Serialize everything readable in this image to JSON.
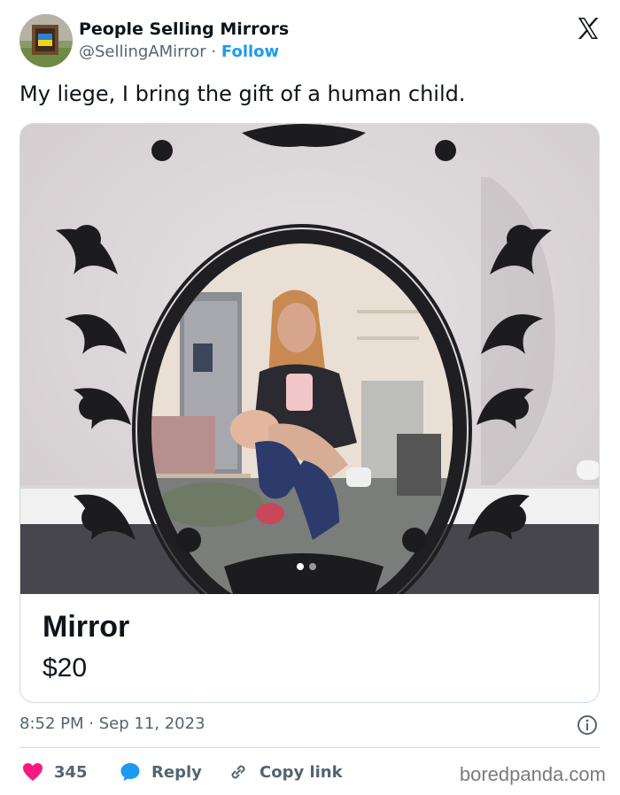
{
  "author": {
    "display_name": "People Selling Mirrors",
    "handle": "@SellingAMirror",
    "separator": "·",
    "follow_label": "Follow"
  },
  "tweet": {
    "text": "My liege, I bring the gift of a human child."
  },
  "listing_card": {
    "title": "Mirror",
    "price": "$20",
    "carousel": {
      "total": 2,
      "current": 1
    }
  },
  "meta": {
    "time": "8:52 PM",
    "separator": "·",
    "date": "Sep 11, 2023"
  },
  "actions": {
    "like_count": "345",
    "reply_label": "Reply",
    "copy_label": "Copy link"
  },
  "watermark": "boredpanda.com",
  "colors": {
    "accent": "#1d9bf0",
    "like": "#f91880",
    "text": "#0f1419",
    "muted": "#536471",
    "border": "#cfd9de"
  },
  "icons": [
    "x-logo-icon",
    "info-icon",
    "heart-icon",
    "reply-bubble-icon",
    "link-icon"
  ]
}
